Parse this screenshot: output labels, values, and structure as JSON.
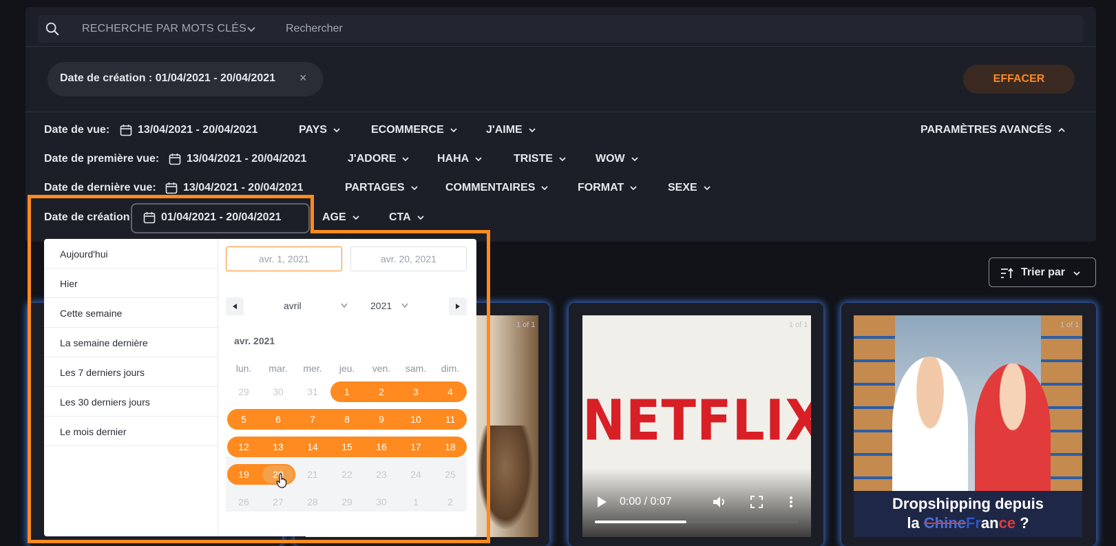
{
  "search": {
    "keyword_select": "RECHERCHE PAR MOTS CLÉS",
    "placeholder": "Rechercher"
  },
  "active_filter_chip": "Date de création : 01/04/2021 - 20/04/2021",
  "chip_close": "×",
  "clear_button": "EFFACER",
  "filters": {
    "date_vue_label": "Date de vue:",
    "date_vue_value": "13/04/2021 - 20/04/2021",
    "date_premiere_label": "Date de première vue:",
    "date_premiere_value": "13/04/2021 - 20/04/2021",
    "date_derniere_label": "Date de dernière vue:",
    "date_derniere_value": "13/04/2021 - 20/04/2021",
    "date_creation_label": "Date de création:",
    "date_creation_value": "01/04/2021 - 20/04/2021",
    "pays": "PAYS",
    "ecommerce": "ECOMMERCE",
    "jaime": "J'AIME",
    "advanced": "PARAMÈTRES AVANCÉS",
    "jadore": "J'ADORE",
    "haha": "HAHA",
    "triste": "TRISTE",
    "wow": "WOW",
    "partages": "PARTAGES",
    "commentaires": "COMMENTAIRES",
    "format": "FORMAT",
    "sexe": "SEXE",
    "age": "AGE",
    "cta": "CTA"
  },
  "datepicker": {
    "presets": [
      "Aujourd'hui",
      "Hier",
      "Cette semaine",
      "La semaine dernière",
      "Les 7 derniers jours",
      "Les 30 derniers jours",
      "Le mois dernier"
    ],
    "start_input": "avr. 1, 2021",
    "end_input": "avr. 20, 2021",
    "month_select": "avril",
    "year_select": "2021",
    "month_title": "avr. 2021",
    "weekdays": [
      "lun.",
      "mar.",
      "mer.",
      "jeu.",
      "ven.",
      "sam.",
      "dim."
    ],
    "weeks": [
      [
        "29",
        "30",
        "31",
        "1",
        "2",
        "3",
        "4"
      ],
      [
        "5",
        "6",
        "7",
        "8",
        "9",
        "10",
        "11"
      ],
      [
        "12",
        "13",
        "14",
        "15",
        "16",
        "17",
        "18"
      ],
      [
        "19",
        "20",
        "21",
        "22",
        "23",
        "24",
        "25"
      ],
      [
        "26",
        "27",
        "28",
        "29",
        "30",
        "1",
        "2"
      ]
    ]
  },
  "sort_button": "Trier par",
  "cards": {
    "count_label": "1 of 1",
    "netflix_logo": "NETFLIX",
    "video_time": "0:00 / 0:07",
    "video_progress": 0.45,
    "dropship_line1": "Dropshipping depuis",
    "dropship_line2_prefix": "la",
    "dropship_struck": "Chine",
    "dropship_france_a": "Fr",
    "dropship_france_b": "an",
    "dropship_france_c": "ce",
    "dropship_q": "?"
  },
  "colors": {
    "accent": "#ff8a1f",
    "card_glow": "#3d6bc7",
    "netflix_red": "#d81f26"
  }
}
